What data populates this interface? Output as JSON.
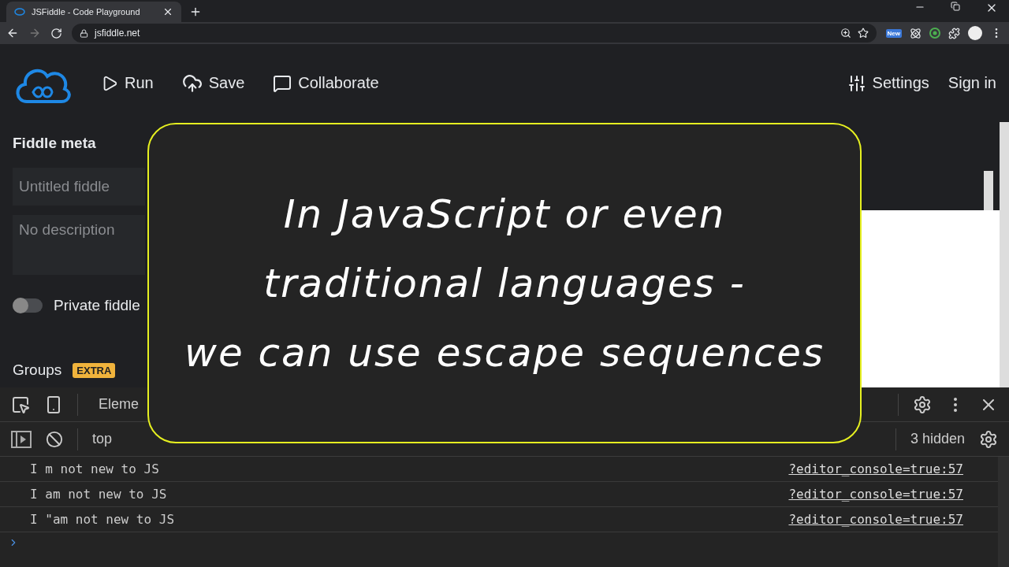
{
  "browser": {
    "tab_title": "JSFiddle - Code Playground",
    "address": "jsfiddle.net",
    "extension_badge": "New"
  },
  "header": {
    "actions": [
      {
        "kind": "run",
        "label": "Run"
      },
      {
        "kind": "save",
        "label": "Save"
      },
      {
        "kind": "collaborate",
        "label": "Collaborate"
      }
    ],
    "settings": "Settings",
    "sign_in": "Sign in"
  },
  "sidebar": {
    "title": "Fiddle meta",
    "name_placeholder": "Untitled fiddle",
    "description_placeholder": "No description",
    "private": {
      "label": "Private fiddle",
      "on": false
    },
    "groups": {
      "label": "Groups",
      "badge": "EXTRA"
    }
  },
  "devtools": {
    "tab": "Eleme",
    "context": "top",
    "hidden": "3 hidden",
    "rows": [
      {
        "message": "I m not new to JS",
        "source": "?editor_console=true:57"
      },
      {
        "message": "I am not new to JS",
        "source": "?editor_console=true:57"
      },
      {
        "message": "I \"am not new to JS",
        "source": "?editor_console=true:57"
      }
    ]
  },
  "caption": {
    "lines": [
      "In JavaScript or even",
      "traditional languages -",
      "we can use escape sequences"
    ]
  }
}
